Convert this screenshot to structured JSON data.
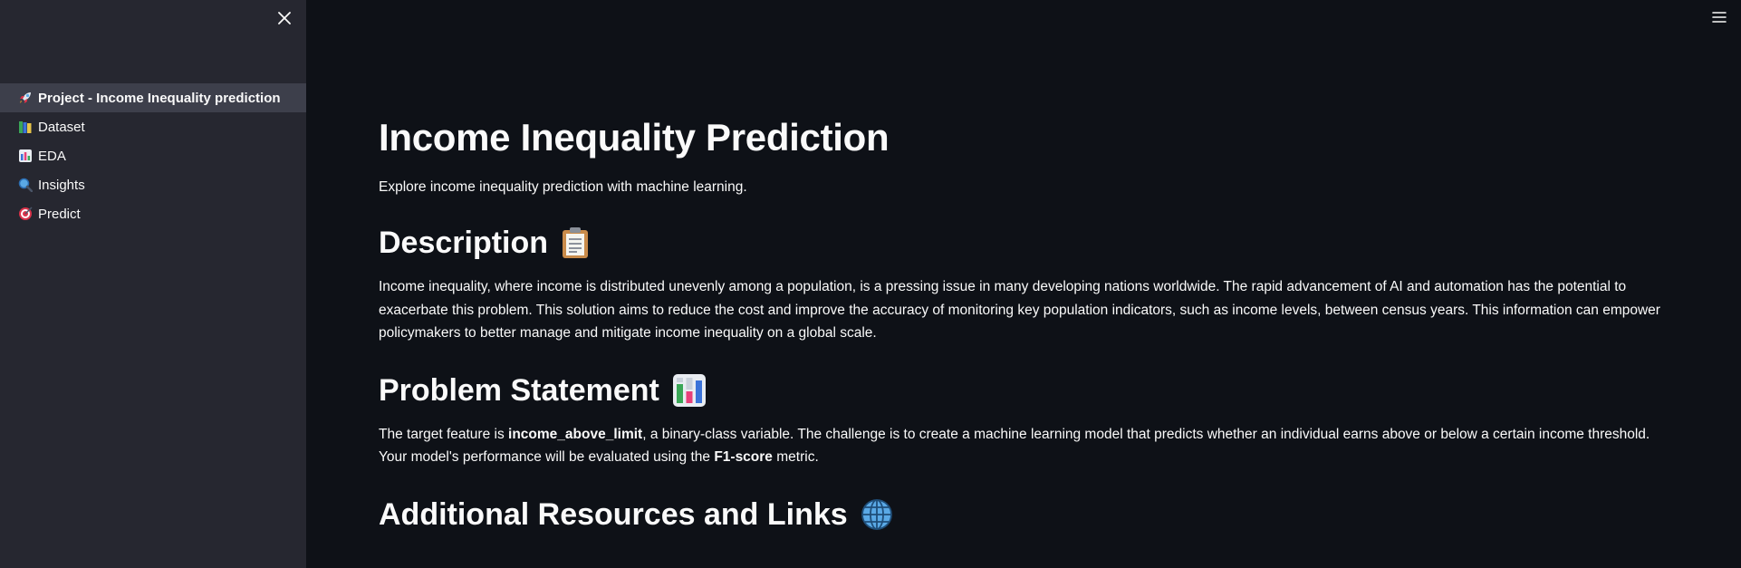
{
  "sidebar": {
    "close_icon": "close-icon",
    "items": [
      {
        "icon": "rocket-icon",
        "emoji": "🚀",
        "label": "Project - Income Inequality prediction",
        "active": true
      },
      {
        "icon": "books-icon",
        "emoji": "📚",
        "label": "Dataset",
        "active": false
      },
      {
        "icon": "bar-chart-icon",
        "emoji": "📊",
        "label": "EDA",
        "active": false
      },
      {
        "icon": "magnifier-icon",
        "emoji": "🔍",
        "label": "Insights",
        "active": false
      },
      {
        "icon": "target-icon",
        "emoji": "🎯",
        "label": "Predict",
        "active": false
      }
    ]
  },
  "header": {
    "menu_icon": "hamburger-menu-icon"
  },
  "main": {
    "title": "Income Inequality Prediction",
    "subtitle": "Explore income inequality prediction with machine learning.",
    "description": {
      "heading": "Description",
      "icon": "clipboard-icon",
      "text": "Income inequality, where income is distributed unevenly among a population, is a pressing issue in many developing nations worldwide. The rapid advancement of AI and automation has the potential to exacerbate this problem. This solution aims to reduce the cost and improve the accuracy of monitoring key population indicators, such as income levels, between census years. This information can empower policymakers to better manage and mitigate income inequality on a global scale."
    },
    "problem": {
      "heading": "Problem Statement",
      "icon": "bar-chart-icon",
      "text_1": "The target feature is ",
      "bold_1": "income_above_limit",
      "text_2": ", a binary-class variable. The challenge is to create a machine learning model that predicts whether an individual earns above or below a certain income threshold. Your model's performance will be evaluated using the ",
      "bold_2": "F1-score",
      "text_3": " metric."
    },
    "resources": {
      "heading": "Additional Resources and Links",
      "icon": "globe-icon"
    }
  },
  "colors": {
    "background": "#0e1117",
    "sidebar": "#262730",
    "sidebar_active": "#3d3f4b",
    "text": "#fafafa"
  }
}
